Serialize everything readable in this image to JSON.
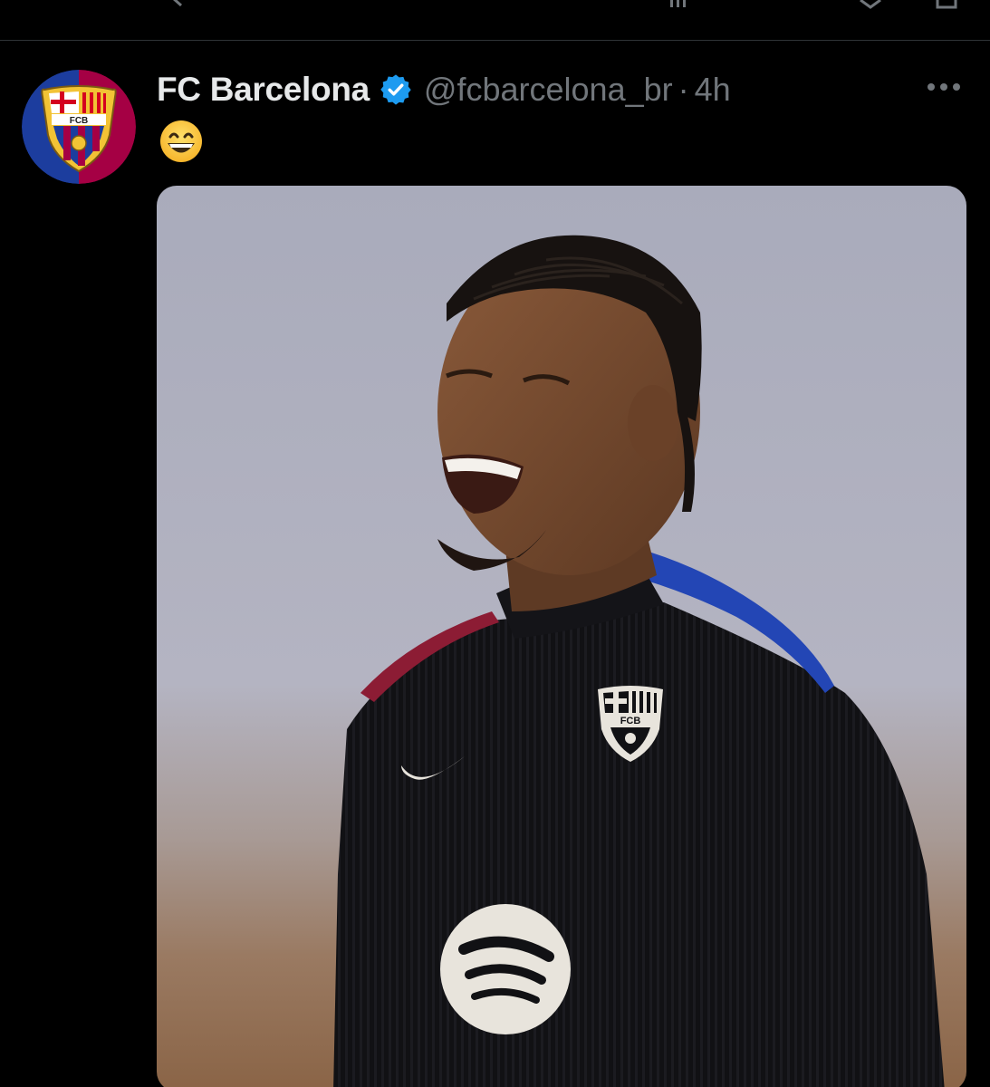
{
  "tweet": {
    "display_name": "FC Barcelona",
    "handle": "@fcbarcelona_br",
    "separator": "·",
    "time": "4h",
    "text_emoji": "grinning-face-with-smiling-eyes",
    "avatar_crest_letters": "FCB"
  },
  "icons": {
    "verified": "verified-badge-icon",
    "more": "more-options-icon",
    "top_actions": [
      "reply-icon",
      "views-icon",
      "bookmark-icon",
      "share-icon"
    ]
  },
  "media": {
    "description_visible": false,
    "shirt_crest_letters": "FCB"
  },
  "colors": {
    "background": "#000000",
    "text_primary": "#e7e9ea",
    "text_secondary": "#71767b",
    "divider": "#2f3336",
    "verified_blue": "#1d9bf0",
    "barca_blue": "#1c3d9e",
    "barca_red": "#a50044"
  }
}
